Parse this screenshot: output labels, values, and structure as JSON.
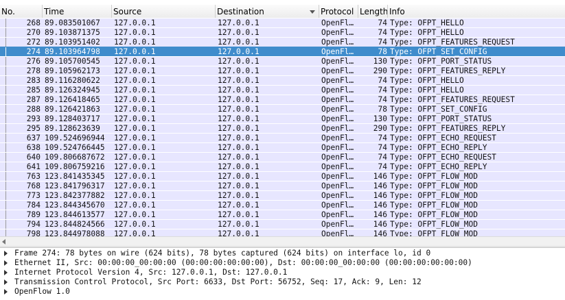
{
  "columns": {
    "no": "No.",
    "time": "Time",
    "source": "Source",
    "destination": "Destination",
    "protocol": "Protocol",
    "length": "Length",
    "info": "Info"
  },
  "selected_index": 3,
  "colors": {
    "row_bg": "#e7e6ff",
    "selected_bg": "#3f8ccc",
    "selected_text": "#ffffff"
  },
  "packets": [
    {
      "no": "268",
      "time": "89.083501067",
      "src": "127.0.0.1",
      "dst": "127.0.0.1",
      "proto": "OpenFl…",
      "len": "74",
      "info": "Type: OFPT_HELLO"
    },
    {
      "no": "270",
      "time": "89.103871375",
      "src": "127.0.0.1",
      "dst": "127.0.0.1",
      "proto": "OpenFl…",
      "len": "74",
      "info": "Type: OFPT_HELLO"
    },
    {
      "no": "272",
      "time": "89.103951402",
      "src": "127.0.0.1",
      "dst": "127.0.0.1",
      "proto": "OpenFl…",
      "len": "74",
      "info": "Type: OFPT_FEATURES_REQUEST"
    },
    {
      "no": "274",
      "time": "89.103964798",
      "src": "127.0.0.1",
      "dst": "127.0.0.1",
      "proto": "OpenFl…",
      "len": "78",
      "info": "Type: OFPT_SET_CONFIG"
    },
    {
      "no": "276",
      "time": "89.105700545",
      "src": "127.0.0.1",
      "dst": "127.0.0.1",
      "proto": "OpenFl…",
      "len": "130",
      "info": "Type: OFPT_PORT_STATUS"
    },
    {
      "no": "278",
      "time": "89.105962173",
      "src": "127.0.0.1",
      "dst": "127.0.0.1",
      "proto": "OpenFl…",
      "len": "290",
      "info": "Type: OFPT_FEATURES_REPLY"
    },
    {
      "no": "283",
      "time": "89.116280622",
      "src": "127.0.0.1",
      "dst": "127.0.0.1",
      "proto": "OpenFl…",
      "len": "74",
      "info": "Type: OFPT_HELLO"
    },
    {
      "no": "285",
      "time": "89.126324945",
      "src": "127.0.0.1",
      "dst": "127.0.0.1",
      "proto": "OpenFl…",
      "len": "74",
      "info": "Type: OFPT_HELLO"
    },
    {
      "no": "287",
      "time": "89.126418465",
      "src": "127.0.0.1",
      "dst": "127.0.0.1",
      "proto": "OpenFl…",
      "len": "74",
      "info": "Type: OFPT_FEATURES_REQUEST"
    },
    {
      "no": "288",
      "time": "89.126421863",
      "src": "127.0.0.1",
      "dst": "127.0.0.1",
      "proto": "OpenFl…",
      "len": "78",
      "info": "Type: OFPT_SET_CONFIG"
    },
    {
      "no": "293",
      "time": "89.128403717",
      "src": "127.0.0.1",
      "dst": "127.0.0.1",
      "proto": "OpenFl…",
      "len": "130",
      "info": "Type: OFPT_PORT_STATUS"
    },
    {
      "no": "295",
      "time": "89.128623639",
      "src": "127.0.0.1",
      "dst": "127.0.0.1",
      "proto": "OpenFl…",
      "len": "290",
      "info": "Type: OFPT_FEATURES_REPLY"
    },
    {
      "no": "637",
      "time": "109.524696944",
      "src": "127.0.0.1",
      "dst": "127.0.0.1",
      "proto": "OpenFl…",
      "len": "74",
      "info": "Type: OFPT_ECHO_REQUEST"
    },
    {
      "no": "638",
      "time": "109.524766445",
      "src": "127.0.0.1",
      "dst": "127.0.0.1",
      "proto": "OpenFl…",
      "len": "74",
      "info": "Type: OFPT_ECHO_REPLY"
    },
    {
      "no": "640",
      "time": "109.806687672",
      "src": "127.0.0.1",
      "dst": "127.0.0.1",
      "proto": "OpenFl…",
      "len": "74",
      "info": "Type: OFPT_ECHO_REQUEST"
    },
    {
      "no": "641",
      "time": "109.806759216",
      "src": "127.0.0.1",
      "dst": "127.0.0.1",
      "proto": "OpenFl…",
      "len": "74",
      "info": "Type: OFPT_ECHO_REPLY"
    },
    {
      "no": "763",
      "time": "123.841435345",
      "src": "127.0.0.1",
      "dst": "127.0.0.1",
      "proto": "OpenFl…",
      "len": "146",
      "info": "Type: OFPT_FLOW_MOD"
    },
    {
      "no": "768",
      "time": "123.841796317",
      "src": "127.0.0.1",
      "dst": "127.0.0.1",
      "proto": "OpenFl…",
      "len": "146",
      "info": "Type: OFPT_FLOW_MOD"
    },
    {
      "no": "773",
      "time": "123.842377882",
      "src": "127.0.0.1",
      "dst": "127.0.0.1",
      "proto": "OpenFl…",
      "len": "146",
      "info": "Type: OFPT_FLOW_MOD"
    },
    {
      "no": "784",
      "time": "123.844345670",
      "src": "127.0.0.1",
      "dst": "127.0.0.1",
      "proto": "OpenFl…",
      "len": "146",
      "info": "Type: OFPT_FLOW_MOD"
    },
    {
      "no": "789",
      "time": "123.844613577",
      "src": "127.0.0.1",
      "dst": "127.0.0.1",
      "proto": "OpenFl…",
      "len": "146",
      "info": "Type: OFPT_FLOW_MOD"
    },
    {
      "no": "794",
      "time": "123.844824566",
      "src": "127.0.0.1",
      "dst": "127.0.0.1",
      "proto": "OpenFl…",
      "len": "146",
      "info": "Type: OFPT_FLOW_MOD"
    },
    {
      "no": "798",
      "time": "123.844978088",
      "src": "127.0.0.1",
      "dst": "127.0.0.1",
      "proto": "OpenFl…",
      "len": "146",
      "info": "Type: OFPT_FLOW_MOD"
    }
  ],
  "details": [
    "Frame 274: 78 bytes on wire (624 bits), 78 bytes captured (624 bits) on interface lo, id 0",
    "Ethernet II, Src: 00:00:00_00:00:00 (00:00:00:00:00:00), Dst: 00:00:00_00:00:00 (00:00:00:00:00:00)",
    "Internet Protocol Version 4, Src: 127.0.0.1, Dst: 127.0.0.1",
    "Transmission Control Protocol, Src Port: 6633, Dst Port: 56752, Seq: 17, Ack: 9, Len: 12",
    "OpenFlow 1.0"
  ]
}
